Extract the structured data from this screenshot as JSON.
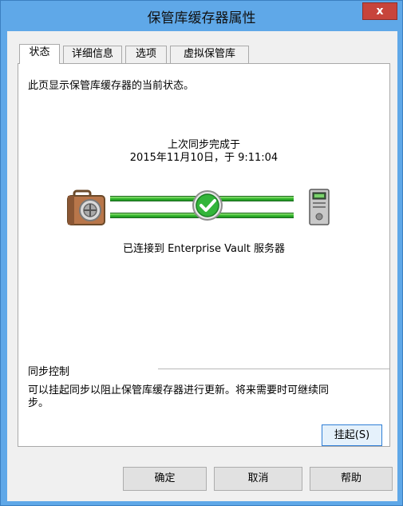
{
  "window": {
    "title": "保管库缓存器属性",
    "close_label": "x"
  },
  "tabs": [
    {
      "label": "状态",
      "active": true
    },
    {
      "label": "详细信息",
      "active": false
    },
    {
      "label": "选项",
      "active": false
    },
    {
      "label": "虚拟保管库",
      "active": false
    }
  ],
  "status": {
    "description": "此页显示保管库缓存器的当前状态。",
    "last_sync_heading": "上次同步完成于",
    "last_sync_time": "2015年11月10日，于 9:11:04",
    "connection_text": "已连接到 Enterprise Vault 服务器",
    "sync_ok": true
  },
  "sync_control": {
    "heading": "同步控制",
    "description_line1": "可以挂起同步以阻止保管库缓存器进行更新。将来需要时可继续同",
    "description_line2": "步。",
    "suspend_label": "挂起(S)"
  },
  "footer": {
    "ok_label": "确定",
    "cancel_label": "取消",
    "help_label": "帮助"
  },
  "colors": {
    "titlebar": "#5fa8e8",
    "pipe": "#31b72c",
    "close": "#c7443b",
    "focus_border": "#2f7ed6"
  },
  "icons": {
    "local": "briefcase-safe-icon",
    "status": "checkmark-icon",
    "server": "server-icon"
  }
}
